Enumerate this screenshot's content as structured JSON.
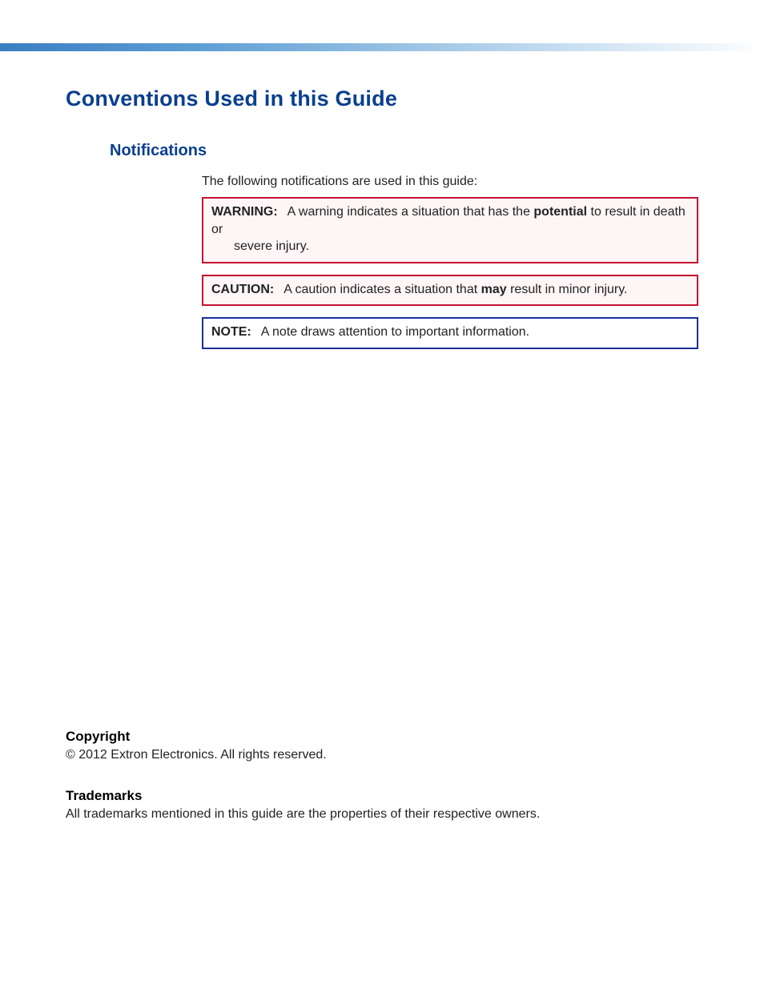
{
  "headings": {
    "main": "Conventions Used in this Guide",
    "sub": "Notifications"
  },
  "intro": "The following notifications are used in this guide:",
  "boxes": {
    "warning": {
      "label": "WARNING:",
      "text_before": "A warning indicates a situation that has the ",
      "bold": "potential",
      "text_after": " to result in death or",
      "line2": "severe injury."
    },
    "caution": {
      "label": "CAUTION:",
      "text_before": "A caution indicates a situation that ",
      "bold": "may",
      "text_after": " result in minor injury."
    },
    "note": {
      "label": "NOTE:",
      "text": "A note draws attention to important information."
    }
  },
  "footer": {
    "copyright_heading": "Copyright",
    "copyright_text": "© 2012  Extron Electronics. All rights reserved.",
    "trademarks_heading": "Trademarks",
    "trademarks_text": "All trademarks mentioned in this guide are the properties of their respective owners."
  }
}
